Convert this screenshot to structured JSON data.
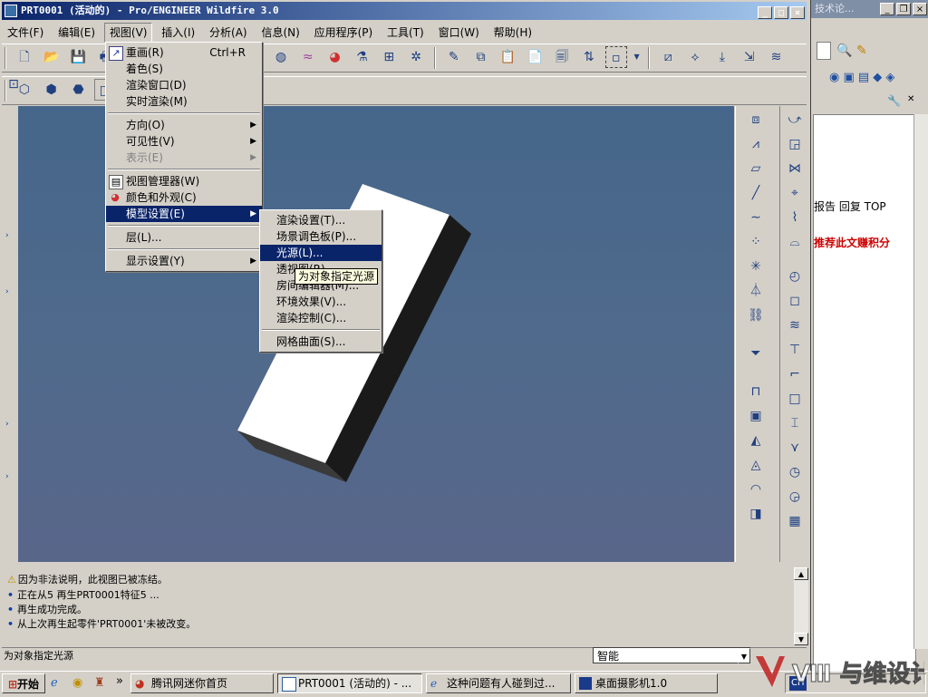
{
  "window": {
    "title": "PRT0001 (活动的) - Pro/ENGINEER Wildfire 3.0",
    "controls": [
      "_",
      "□",
      "×"
    ]
  },
  "menubar": [
    {
      "label": "文件(F)"
    },
    {
      "label": "编辑(E)"
    },
    {
      "label": "视图(V)"
    },
    {
      "label": "插入(I)"
    },
    {
      "label": "分析(A)"
    },
    {
      "label": "信息(N)"
    },
    {
      "label": "应用程序(P)"
    },
    {
      "label": "工具(T)"
    },
    {
      "label": "窗口(W)"
    },
    {
      "label": "帮助(H)"
    }
  ],
  "view_menu": {
    "items": [
      {
        "label": "重画(R)",
        "shortcut": "Ctrl+R"
      },
      {
        "label": "着色(S)"
      },
      {
        "label": "渲染窗口(D)"
      },
      {
        "label": "实时渲染(M)"
      },
      {
        "label": "方向(O)"
      },
      {
        "label": "可见性(V)"
      },
      {
        "label": "表示(E)"
      },
      {
        "label": "视图管理器(W)"
      },
      {
        "label": "颜色和外观(C)"
      },
      {
        "label": "模型设置(E)"
      },
      {
        "label": "层(L)..."
      },
      {
        "label": "显示设置(Y)"
      }
    ]
  },
  "model_setup_menu": {
    "items": [
      {
        "label": "渲染设置(T)..."
      },
      {
        "label": "场景调色板(P)..."
      },
      {
        "label": "光源(L)..."
      },
      {
        "label": "透视图(R)..."
      },
      {
        "label": "房间编辑器(M)..."
      },
      {
        "label": "环境效果(V)..."
      },
      {
        "label": "渲染控制(C)..."
      },
      {
        "label": "网格曲面(S)..."
      }
    ]
  },
  "tooltip": "为对象指定光源",
  "messages": [
    {
      "text": "因为非法说明，此视图已被冻结。"
    },
    {
      "text": "正在从5 再生PRT0001特征5 ..."
    },
    {
      "text": "再生成功完成。"
    },
    {
      "text": "从上次再生起零件'PRT0001'未被改变。"
    }
  ],
  "status_text": "为对象指定光源",
  "filter_value": "智能",
  "browser": {
    "title": "技术论...",
    "links": "报告 回复 TOP",
    "promo": "推荐此文赚积分"
  },
  "taskbar": {
    "start": "开始",
    "quick_more": "»",
    "buttons": [
      {
        "label": "腾讯网迷你首页"
      },
      {
        "label": "PRT0001 (活动的) - ..."
      },
      {
        "label": "这种问题有人碰到过..."
      },
      {
        "label": "桌面摄影机1.0"
      }
    ],
    "tray_lang": "CH",
    "watermark": "Ⅷ 与维设计"
  },
  "colors": {
    "title_start": "#0a246a",
    "title_end": "#a6caf0",
    "menu_highlight": "#0a246a",
    "graphics_bg": "#4a6a8c",
    "face_white": "#ffffff",
    "face_dark": "#1a1a1a",
    "promo_red": "#cc0000"
  }
}
